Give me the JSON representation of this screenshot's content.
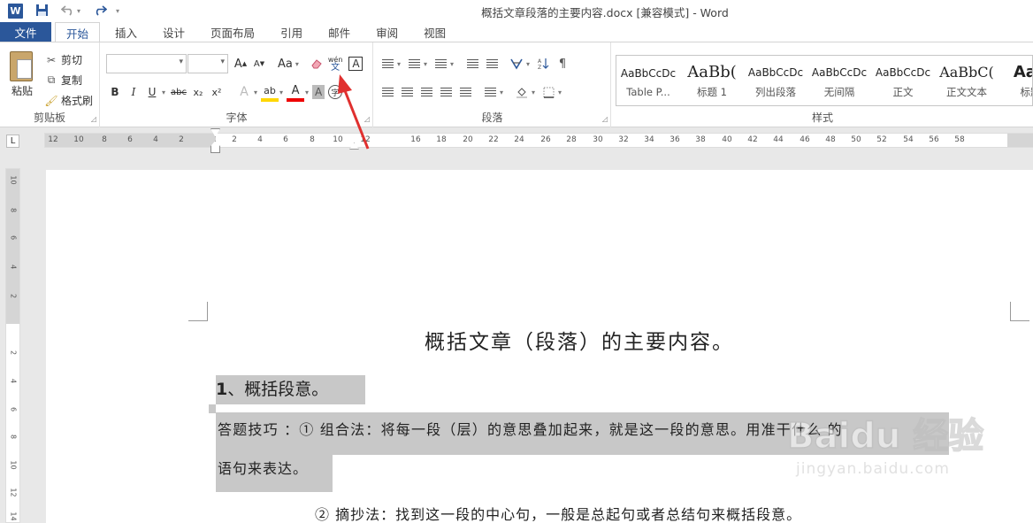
{
  "window": {
    "title": "概括文章段落的主要内容.docx [兼容模式] - Word",
    "app_icon_letter": "W"
  },
  "tabs": {
    "file": "文件",
    "items": [
      "开始",
      "插入",
      "设计",
      "页面布局",
      "引用",
      "邮件",
      "审阅",
      "视图"
    ],
    "active": "开始"
  },
  "clipboard": {
    "paste": "粘贴",
    "cut": "剪切",
    "copy": "复制",
    "format_painter": "格式刷",
    "label": "剪贴板"
  },
  "font": {
    "label": "字体",
    "grow": "A",
    "shrink": "A",
    "case": "Aa",
    "phonetic_top": "wén",
    "phonetic_bottom": "文",
    "border_char": "A",
    "bold": "B",
    "italic": "I",
    "underline": "U",
    "strike": "abc",
    "sub": "x₂",
    "sup": "x²",
    "effects": "A",
    "highlight": "ab",
    "color": "A",
    "shade": "A",
    "enclose": "字"
  },
  "paragraph": {
    "label": "段落"
  },
  "styles": {
    "label": "样式",
    "items": [
      {
        "sample": "AaBbCcDc",
        "name": "Table P..."
      },
      {
        "sample": "AaBb(",
        "name": "标题 1"
      },
      {
        "sample": "AaBbCcDc",
        "name": "列出段落"
      },
      {
        "sample": "AaBbCcDc",
        "name": "无间隔"
      },
      {
        "sample": "AaBbCcDc",
        "name": "正文"
      },
      {
        "sample": "AaBbC(",
        "name": "正文文本"
      },
      {
        "sample": "AaE",
        "name": "标题"
      }
    ]
  },
  "ruler": {
    "corner": "L",
    "ticks_left": [
      "12",
      "10",
      "8",
      "6",
      "4",
      "2"
    ],
    "ticks_right": [
      "2",
      "4",
      "6",
      "8",
      "10",
      "12",
      "16",
      "18",
      "20",
      "22",
      "24",
      "26",
      "28",
      "30",
      "32",
      "34",
      "36",
      "38",
      "40",
      "42",
      "44",
      "46",
      "48",
      "50",
      "52",
      "54",
      "56",
      "58"
    ],
    "vticks": [
      "10",
      "8",
      "6",
      "4",
      "2",
      "2",
      "4",
      "6",
      "8",
      "10",
      "12",
      "14"
    ]
  },
  "document": {
    "title": "概括文章（段落）的主要内容。",
    "heading_num": "1",
    "heading_text": "、概括段意。",
    "line1": "答题技巧 ：① 组合法：将每一段（层）的意思叠加起来，就是这一段的意思。用准干什么 的",
    "line2": "语句来表达。",
    "line3": "② 摘抄法：找到这一段的中心句，一般是总起句或者总结句来概括段意。"
  },
  "watermark": {
    "brand": "Baidu 经验",
    "url": "jingyan.baidu.com"
  }
}
